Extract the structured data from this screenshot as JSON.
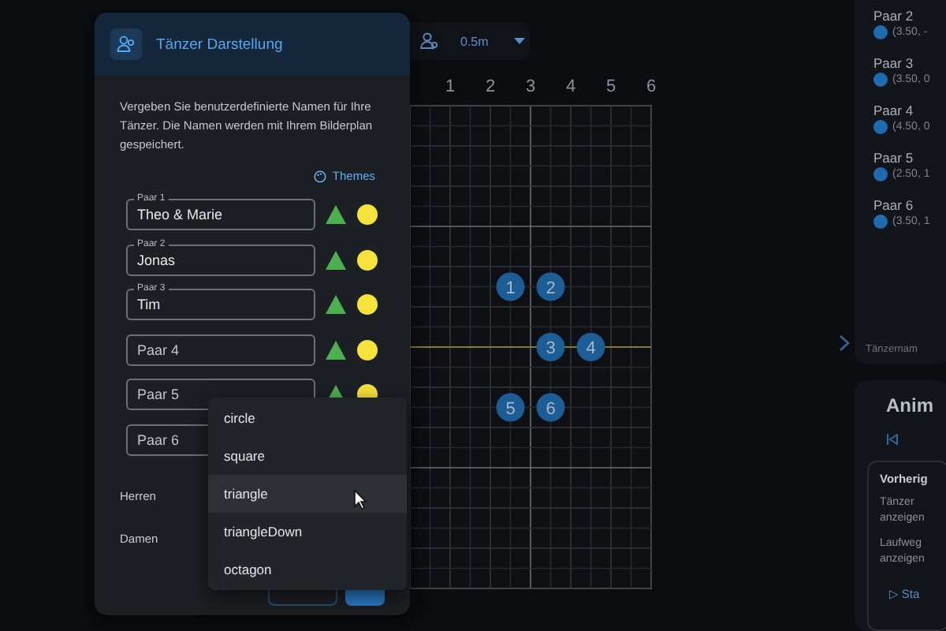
{
  "toolbar": {
    "grid_size": "0.5m"
  },
  "board": {
    "x_labels": [
      "1",
      "2",
      "3",
      "4",
      "5",
      "6"
    ],
    "dancers": [
      {
        "label": "1"
      },
      {
        "label": "2"
      },
      {
        "label": "3"
      },
      {
        "label": "4"
      },
      {
        "label": "5"
      },
      {
        "label": "6"
      }
    ]
  },
  "positions_panel": {
    "items": [
      {
        "name": "Paar 2",
        "coords": "(3.50, -"
      },
      {
        "name": "Paar 3",
        "coords": "(3.50, 0"
      },
      {
        "name": "Paar 4",
        "coords": "(4.50, 0"
      },
      {
        "name": "Paar 5",
        "coords": "(2.50, 1"
      },
      {
        "name": "Paar 6",
        "coords": "(3.50, 1"
      }
    ],
    "footer": "Tänzernam"
  },
  "animation_panel": {
    "title": "Anim",
    "options_title": "Vorherig",
    "options": [
      "Tänzer anzeigen",
      "Laufweg anzeigen"
    ],
    "start_button": "▷ Sta"
  },
  "dialog": {
    "title": "Tänzer Darstellung",
    "description": "Vergeben Sie benutzerdefinierte Namen für Ihre Tänzer. Die Namen werden mit Ihrem Bilderplan gespeichert.",
    "themes_link": "Themes",
    "pairs": [
      {
        "label": "Paar 1",
        "value": "Theo & Marie"
      },
      {
        "label": "Paar 2",
        "value": "Jonas"
      },
      {
        "label": "Paar 3",
        "value": "Tim"
      },
      {
        "label": "Paar 4"
      },
      {
        "label": "Paar 5"
      },
      {
        "label": "Paar 6"
      }
    ],
    "herren_label": "Herren",
    "damen_label": "Damen"
  },
  "shape_menu": {
    "options": [
      {
        "label": "circle",
        "selected": false
      },
      {
        "label": "square",
        "selected": false
      },
      {
        "label": "triangle",
        "selected": true
      },
      {
        "label": "triangleDown",
        "selected": false
      },
      {
        "label": "octagon",
        "selected": false
      }
    ]
  }
}
